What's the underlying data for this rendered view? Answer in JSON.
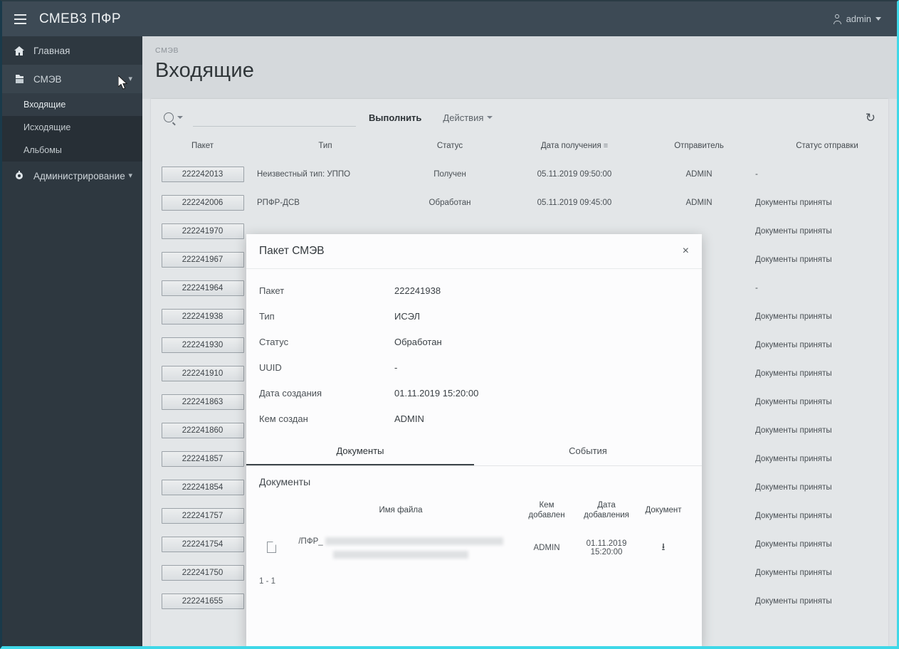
{
  "app": {
    "title": "СМЕВ3 ПФР",
    "menu_icon": "hamburger-icon",
    "user": "admin"
  },
  "sidebar": {
    "items": [
      {
        "label": "Главная",
        "icon": "home-icon",
        "expandable": false
      },
      {
        "label": "СМЭВ",
        "icon": "exchange-icon",
        "expandable": true,
        "expanded": true
      },
      {
        "label": "Администрирование",
        "icon": "gear-icon",
        "expandable": true,
        "expanded": false
      }
    ],
    "submenu": [
      {
        "label": "Входящие",
        "selected": true
      },
      {
        "label": "Исходящие",
        "selected": false
      },
      {
        "label": "Альбомы",
        "selected": false
      }
    ]
  },
  "page": {
    "breadcrumb": "СМЭВ",
    "title": "Входящие"
  },
  "toolbar": {
    "search_placeholder": "",
    "search_value": "",
    "execute_label": "Выполнить",
    "actions_label": "Действия",
    "refresh_icon": "refresh-icon",
    "search_icon": "search-icon"
  },
  "table": {
    "columns": [
      {
        "label": "Пакет",
        "sorted": false
      },
      {
        "label": "Тип",
        "sorted": false
      },
      {
        "label": "Статус",
        "sorted": false
      },
      {
        "label": "Дата получения",
        "sorted": true
      },
      {
        "label": "Отправитель",
        "sorted": false
      },
      {
        "label": "Статус отправки",
        "sorted": false
      }
    ],
    "rows": [
      {
        "packet": "222242013",
        "type": "Неизвестный тип: УППО",
        "status": "Получен",
        "date": "05.11.2019 09:50:00",
        "sender": "ADMIN",
        "send_status": "-"
      },
      {
        "packet": "222242006",
        "type": "РПФР-ДСВ",
        "status": "Обработан",
        "date": "05.11.2019 09:45:00",
        "sender": "ADMIN",
        "send_status": "Документы приняты"
      },
      {
        "packet": "222241970",
        "type": "",
        "status": "",
        "date": "",
        "sender": "",
        "send_status": "Документы приняты"
      },
      {
        "packet": "222241967",
        "type": "",
        "status": "",
        "date": "",
        "sender": "",
        "send_status": "Документы приняты"
      },
      {
        "packet": "222241964",
        "type": "",
        "status": "",
        "date": "",
        "sender": "",
        "send_status": "-"
      },
      {
        "packet": "222241938",
        "type": "",
        "status": "",
        "date": "",
        "sender": "",
        "send_status": "Документы приняты"
      },
      {
        "packet": "222241930",
        "type": "",
        "status": "",
        "date": "",
        "sender": "",
        "send_status": "Документы приняты"
      },
      {
        "packet": "222241910",
        "type": "",
        "status": "",
        "date": "",
        "sender": "",
        "send_status": "Документы приняты"
      },
      {
        "packet": "222241863",
        "type": "",
        "status": "",
        "date": "",
        "sender": "",
        "send_status": "Документы приняты"
      },
      {
        "packet": "222241860",
        "type": "",
        "status": "",
        "date": "",
        "sender": "",
        "send_status": "Документы приняты"
      },
      {
        "packet": "222241857",
        "type": "",
        "status": "",
        "date": "",
        "sender": "",
        "send_status": "Документы приняты"
      },
      {
        "packet": "222241854",
        "type": "",
        "status": "",
        "date": "",
        "sender": "",
        "send_status": "Документы приняты"
      },
      {
        "packet": "222241757",
        "type": "",
        "status": "",
        "date": "",
        "sender": "",
        "send_status": "Документы приняты"
      },
      {
        "packet": "222241754",
        "type": "",
        "status": "",
        "date": "",
        "sender": "",
        "send_status": "Документы приняты"
      },
      {
        "packet": "222241750",
        "type": "",
        "status": "",
        "date": "",
        "sender": "",
        "send_status": "Документы приняты"
      },
      {
        "packet": "222241655",
        "type": "",
        "status": "",
        "date": "",
        "sender": "",
        "send_status": "Документы приняты"
      }
    ]
  },
  "modal": {
    "title": "Пакет СМЭВ",
    "close_label": "×",
    "fields": [
      {
        "label": "Пакет",
        "value": "222241938"
      },
      {
        "label": "Тип",
        "value": "ИСЭЛ"
      },
      {
        "label": "Статус",
        "value": "Обработан"
      },
      {
        "label": "UUID",
        "value": "-"
      },
      {
        "label": "Дата создания",
        "value": "01.11.2019 15:20:00"
      },
      {
        "label": "Кем создан",
        "value": "ADMIN"
      }
    ],
    "tabs": [
      {
        "label": "Документы",
        "active": true
      },
      {
        "label": "События",
        "active": false
      }
    ],
    "documents": {
      "section_title": "Документы",
      "columns": [
        "",
        "Имя файла",
        "Кем добавлен",
        "Дата добавления",
        "Документ"
      ],
      "rows": [
        {
          "file_icon": "file-icon",
          "filename": "/ПФР_",
          "added_by": "ADMIN",
          "added_date": "01.11.2019 15:20:00",
          "download_icon": "download-icon"
        }
      ],
      "pager": "1 - 1"
    }
  }
}
